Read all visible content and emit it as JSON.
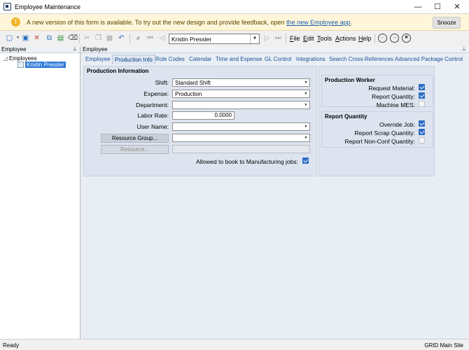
{
  "window": {
    "title": "Employee Maintenance",
    "minimize": "—",
    "maximize": "☐",
    "close": "✕"
  },
  "banner": {
    "message": "A new version of this form is available. To try out the new design and provide feedback, open ",
    "link": "the new Employee app",
    "link_suffix": ".",
    "snooze": "Snooze",
    "icon": "!"
  },
  "toolbar": {
    "employee_value": "Kristin Pressler",
    "menus": [
      {
        "label": "File",
        "key": "F"
      },
      {
        "label": "Edit",
        "key": "E"
      },
      {
        "label": "Tools",
        "key": "T"
      },
      {
        "label": "Actions",
        "key": "A"
      },
      {
        "label": "Help",
        "key": "H"
      }
    ],
    "icons": [
      "new-icon",
      "save-icon",
      "delete-icon",
      "copy-icon",
      "excel-icon",
      "clear-icon",
      "cut-icon",
      "copy2-icon",
      "paste-icon",
      "undo-icon",
      "search-icon",
      "first-icon",
      "prev-icon",
      "next-icon",
      "last-icon",
      "back-icon",
      "forward-icon",
      "stop-icon"
    ]
  },
  "left_panel": {
    "header": "Employee",
    "tree_root": "Employees",
    "tree_child": "Kristin Pressler"
  },
  "right_panel": {
    "header": "Employee",
    "tabs": [
      "Employee",
      "Production Info",
      "Role Codes",
      "Calendar",
      "Time and Expense",
      "GL Control",
      "Integrations",
      "Search Cross-References",
      "Advanced Package Control"
    ],
    "active_tab": "Production Info"
  },
  "production_info": {
    "group_title": "Production Information",
    "shift_label": "Shift:",
    "shift_value": "Standard Shift",
    "expense_label": "Expense:",
    "expense_value": "Production",
    "department_label": "Department:",
    "department_value": "",
    "labor_rate_label": "Labor Rate:",
    "labor_rate_value": "0.0000",
    "user_name_label": "User Name:",
    "user_name_value": "",
    "resource_group_button": "Resource Group...",
    "resource_group_value": "",
    "resource_button": "Resource...",
    "resource_value": "",
    "allowed_label": "Allowed to book to Manufacturing jobs:",
    "allowed_checked": true
  },
  "production_worker": {
    "group_title": "Production Worker",
    "request_material_label": "Request Material:",
    "request_material_checked": true,
    "report_quantity_label": "Report Quantity:",
    "report_quantity_checked": true,
    "machine_mes_label": "Machine MES:",
    "machine_mes_checked": false
  },
  "report_quantity": {
    "group_title": "Report Quantity",
    "override_job_label": "Override Job:",
    "override_job_checked": true,
    "report_scrap_label": "Report Scrap Quantity:",
    "report_scrap_checked": true,
    "report_nonconf_label": "Report Non-Conf Quantity:",
    "report_nonconf_checked": false
  },
  "status": {
    "left": "Ready",
    "right": "GRID   Main Site"
  }
}
